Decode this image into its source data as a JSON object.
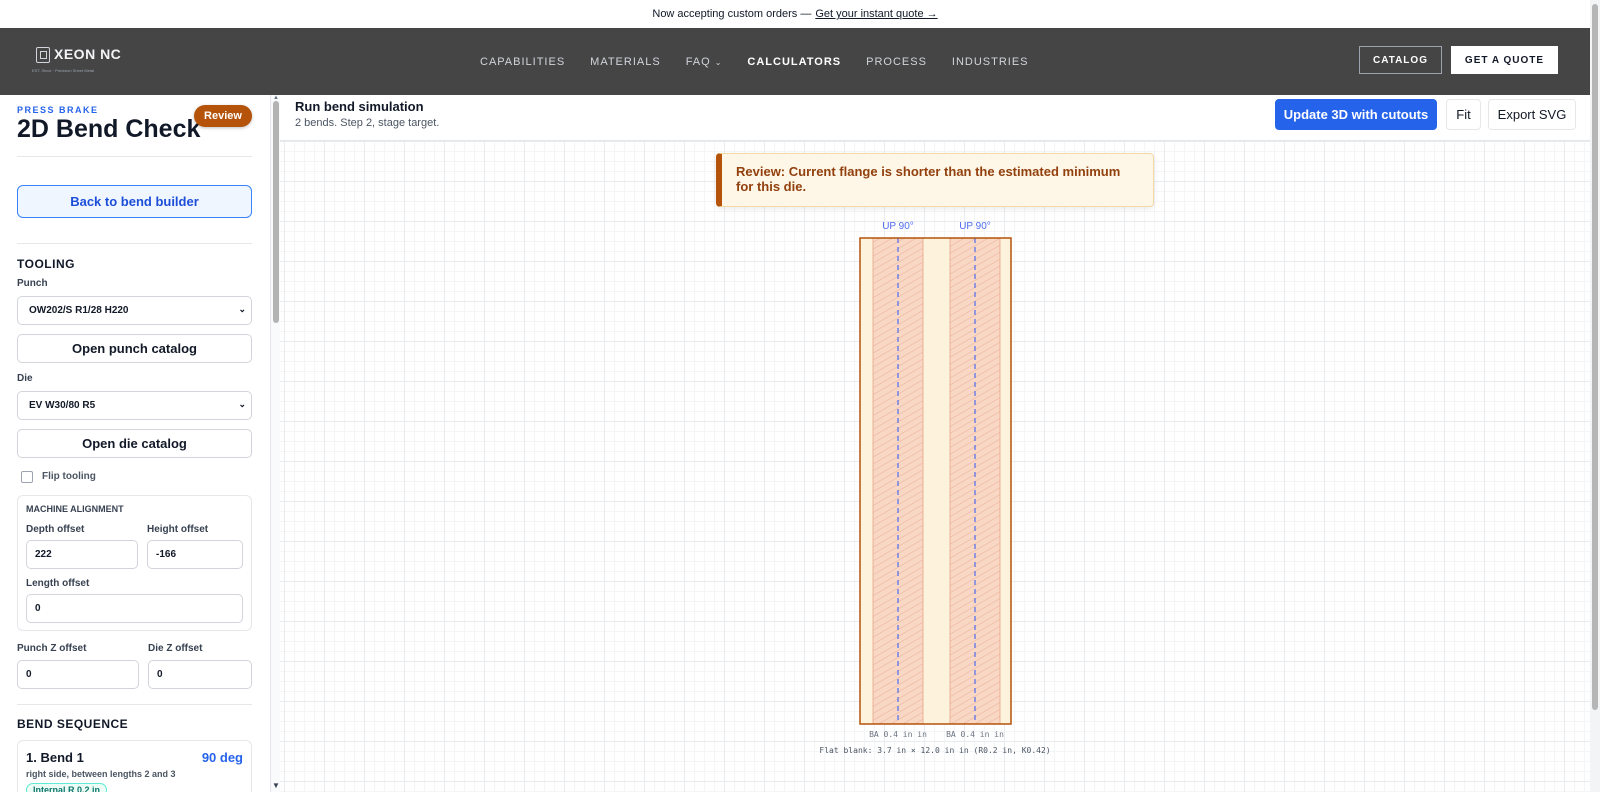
{
  "announcement": {
    "text": "Now accepting custom orders —",
    "link": "Get your instant quote →"
  },
  "header": {
    "logo_text": "XEON NC",
    "logo_tagline": "EST. Since · Precision Sheet Metal",
    "nav": [
      {
        "label": "CAPABILITIES",
        "active": false
      },
      {
        "label": "MATERIALS",
        "active": false
      },
      {
        "label": "FAQ",
        "active": false,
        "has_dropdown": true
      },
      {
        "label": "CALCULATORS",
        "active": true
      },
      {
        "label": "PROCESS",
        "active": false
      },
      {
        "label": "INDUSTRIES",
        "active": false
      }
    ],
    "catalog_button": "CATALOG",
    "quote_button": "GET A QUOTE",
    "colors": {
      "header_bg": "#454545",
      "quote_bg": "#ffffff"
    }
  },
  "sidebar": {
    "eyebrow": "PRESS BRAKE",
    "title": "2D Bend Check",
    "status_pill": "Review",
    "back_button": "Back to bend builder",
    "tooling": {
      "heading": "TOOLING",
      "punch_label": "Punch",
      "punch_value": "OW202/S R1/28 H220",
      "punch_catalog_button": "Open punch catalog",
      "die_label": "Die",
      "die_value": "EV W30/80 R5",
      "die_catalog_button": "Open die catalog",
      "flip_label": "Flip tooling",
      "flip_checked": false
    },
    "machine_alignment": {
      "heading": "MACHINE ALIGNMENT",
      "depth_label": "Depth offset",
      "depth_value": "222",
      "height_label": "Height offset",
      "height_value": "-166",
      "length_label": "Length offset",
      "length_value": "0"
    },
    "punch_z_label": "Punch Z offset",
    "punch_z_value": "0",
    "die_z_label": "Die Z offset",
    "die_z_value": "0",
    "bend_sequence": {
      "heading": "BEND SEQUENCE",
      "bends": [
        {
          "name": "1. Bend 1",
          "angle": "90 deg",
          "desc": "right side, between lengths 2 and 3",
          "tag": "Internal R 0.2 in"
        }
      ]
    }
  },
  "main": {
    "title": "Run bend simulation",
    "subtitle": "2 bends. Step 2, stage target.",
    "update_button": "Update 3D with cutouts",
    "fit_button": "Fit",
    "export_button": "Export SVG",
    "review_message": "Review: Current flange is shorter than the estimated minimum for this die.",
    "drawing": {
      "bend_labels": [
        "UP 90°",
        "UP 90°"
      ],
      "ba_labels": [
        "BA 0.4 in in",
        "BA 0.4 in in"
      ],
      "flat_blank": "Flat blank: 3.7 in × 12.0 in in  (R0.2 in, K0.42)",
      "colors": {
        "outline": "#b45309",
        "fill": "#fdf2dc",
        "bend_zone": "#f8d7c4",
        "hatch": "#e8a48a",
        "bend_line": "#4f6cf0"
      }
    }
  }
}
